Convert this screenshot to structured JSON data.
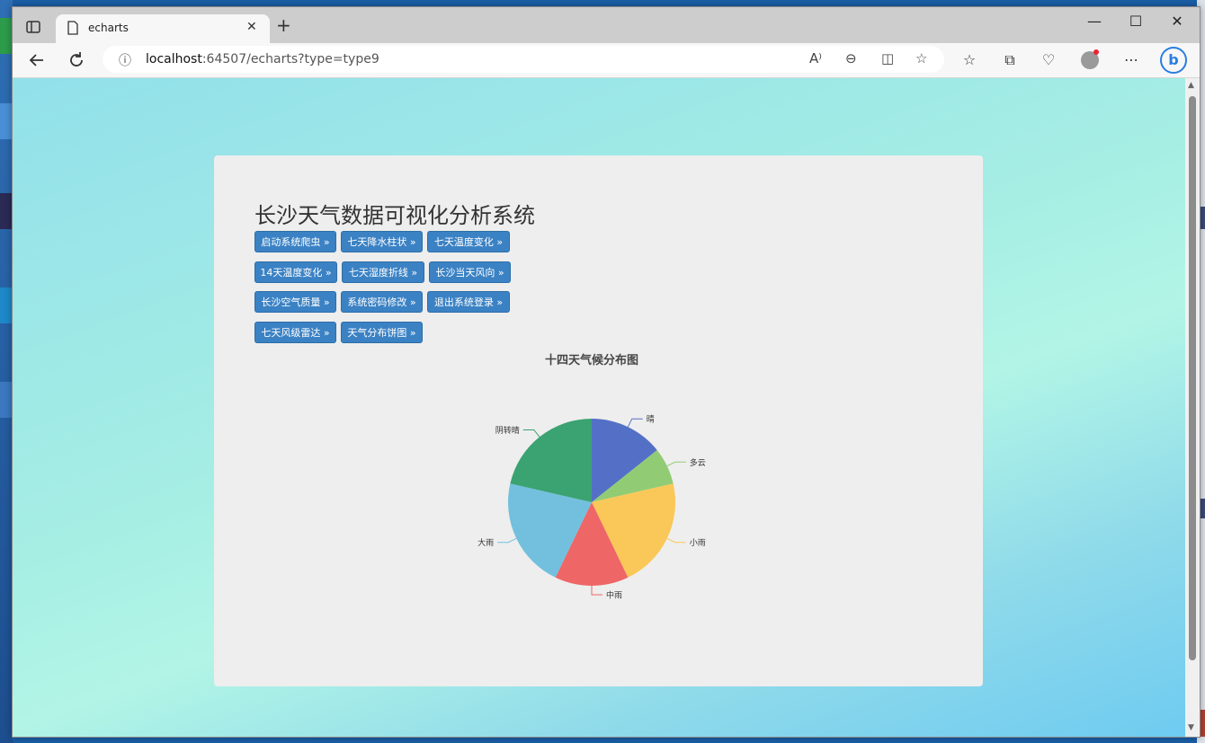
{
  "browser": {
    "tab_title": "echarts",
    "tab_close": "✕",
    "new_tab": "+",
    "address_host": "localhost",
    "address_rest": ":64507/echarts?type=type9",
    "window_controls": [
      "—",
      "☐",
      "✕"
    ]
  },
  "page": {
    "title": "长沙天气数据可视化分析系统",
    "buttons": [
      "启动系统爬虫 »",
      "七天降水柱状 »",
      "七天温度变化 »",
      "14天温度变化 »",
      "七天湿度折线 »",
      "长沙当天风向 »",
      "长沙空气质量 »",
      "系统密码修改 »",
      "退出系统登录 »",
      "七天风级雷达 »",
      "天气分布饼图 »"
    ]
  },
  "chart_data": {
    "type": "pie",
    "title": "十四天气候分布图",
    "slices": [
      {
        "name": "晴",
        "value": 2,
        "color": "#5470c6"
      },
      {
        "name": "多云",
        "value": 1,
        "color": "#91cc75"
      },
      {
        "name": "小雨",
        "value": 3,
        "color": "#fac858"
      },
      {
        "name": "中雨",
        "value": 2,
        "color": "#ee6666"
      },
      {
        "name": "大雨",
        "value": 3,
        "color": "#73c0de"
      },
      {
        "name": "阴转晴",
        "value": 3,
        "color": "#3ba272"
      }
    ]
  }
}
